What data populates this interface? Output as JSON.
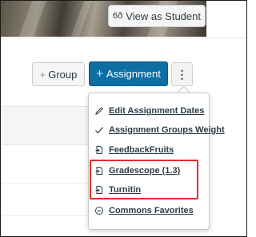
{
  "header": {
    "view_as_student_label": "View as Student"
  },
  "toolbar": {
    "group_label": "Group",
    "assignment_label": "Assignment",
    "kebab_label": "⋮"
  },
  "menu": {
    "items": [
      {
        "label": "Edit Assignment Dates",
        "icon": "pencil-icon"
      },
      {
        "label": "Assignment Groups Weight",
        "icon": "checkmark-icon"
      },
      {
        "label": "FeedbackFruits",
        "icon": "external-tool-icon"
      },
      {
        "label": "Gradescope (1.3)",
        "icon": "external-tool-icon"
      },
      {
        "label": "Turnitin",
        "icon": "external-tool-icon"
      },
      {
        "label": "Commons Favorites",
        "icon": "commons-icon"
      }
    ]
  },
  "colors": {
    "primary": "#0b6fa4",
    "highlight": "#e02f2f"
  }
}
